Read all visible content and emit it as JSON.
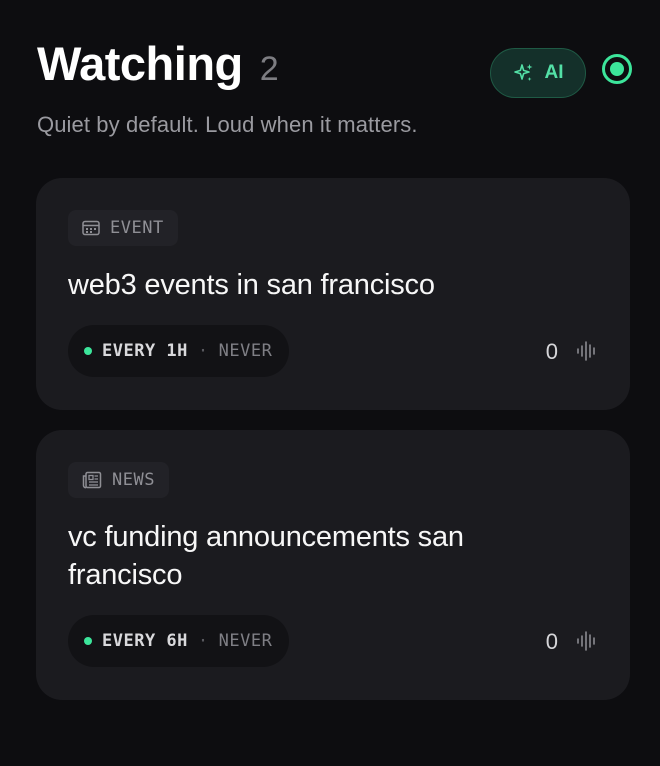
{
  "header": {
    "title": "Watching",
    "count": "2",
    "ai_button_label": "AI",
    "subtitle": "Quiet by default. Loud when it matters."
  },
  "colors": {
    "accent": "#3ce59b",
    "background": "#0d0d10",
    "card": "#1b1b1f"
  },
  "watches": [
    {
      "type_icon": "calendar-icon",
      "type": "EVENT",
      "title": "web3 events in san francisco",
      "frequency": "EVERY 1H",
      "separator": "·",
      "last_run": "NEVER",
      "hits": "0"
    },
    {
      "type_icon": "newspaper-icon",
      "type": "NEWS",
      "title": "vc funding announcements san francisco",
      "frequency": "EVERY 6H",
      "separator": "·",
      "last_run": "NEVER",
      "hits": "0"
    }
  ]
}
